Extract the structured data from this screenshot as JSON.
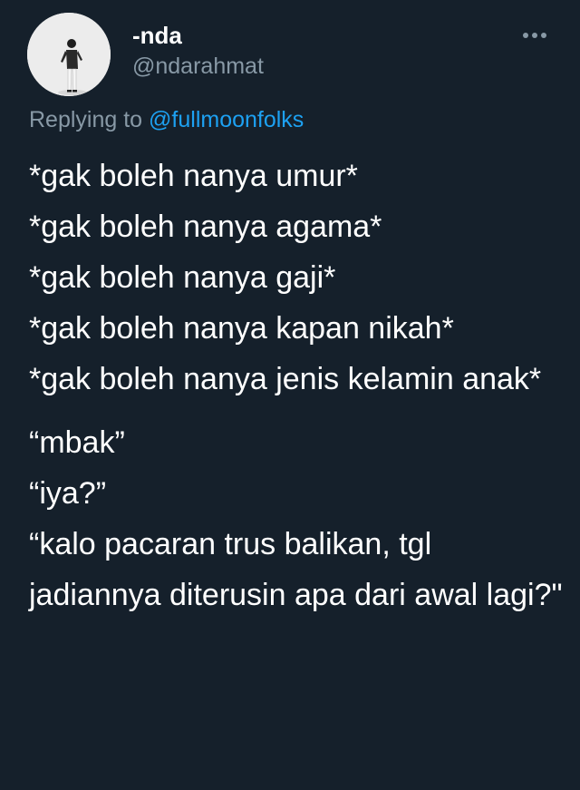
{
  "author": {
    "display_name": "-nda",
    "handle": "@ndarahmat",
    "avatar_icon": "user-avatar-photo"
  },
  "more_icon": "more-horizontal-icon",
  "reply": {
    "prefix": "Replying to ",
    "mention": "@fullmoonfolks"
  },
  "body": {
    "lines": [
      "*gak boleh nanya umur*",
      "*gak boleh nanya agama*",
      "*gak boleh nanya gaji*",
      "*gak boleh nanya kapan nikah*",
      "*gak boleh nanya jenis kelamin anak*"
    ],
    "dialogue": [
      "“mbak”",
      "“iya?”",
      "“kalo pacaran trus balikan, tgl jadiannya diterusin apa dari awal lagi?\""
    ]
  },
  "colors": {
    "background": "#15202b",
    "primary_text": "#ffffff",
    "secondary_text": "#8899a6",
    "link": "#1da1f2"
  }
}
